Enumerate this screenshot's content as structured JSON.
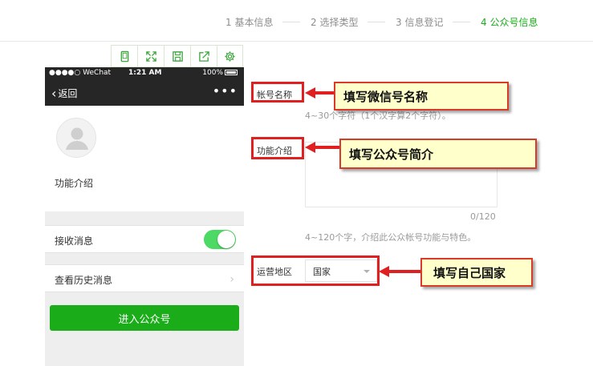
{
  "steps": [
    {
      "label": "1 基本信息",
      "active": false
    },
    {
      "label": "2 选择类型",
      "active": false
    },
    {
      "label": "3 信息登记",
      "active": false
    },
    {
      "label": "4 公众号信息",
      "active": true
    }
  ],
  "toolbar": {
    "icons": [
      "phone-icon",
      "fullscreen-icon",
      "save-icon",
      "share-icon",
      "settings-icon"
    ]
  },
  "phone": {
    "status": {
      "carrier": "●●●●○ WeChat",
      "time": "1:21 AM",
      "battery": "100%"
    },
    "nav": {
      "back_label": "返回",
      "more": "•••"
    },
    "profile": {
      "intro_label": "功能介绍"
    },
    "receive_label": "接收消息",
    "receive_enabled": true,
    "history_label": "查看历史消息",
    "enter_button": "进入公众号"
  },
  "form": {
    "account_name_label": "帐号名称",
    "account_name_hint": "4~30个字符（1个汉字算2个字符）。",
    "intro_label": "功能介绍",
    "intro_counter": "0/120",
    "intro_hint": "4~120个字，介绍此公众帐号功能与特色。",
    "region_label": "运营地区",
    "region_value": "国家"
  },
  "callouts": {
    "name": "填写微信号名称",
    "intro": "填写公众号简介",
    "country": "填写自己国家"
  },
  "colors": {
    "accent": "#1aad19",
    "highlight": "#e02020",
    "callout_bg": "#ffffcc"
  }
}
